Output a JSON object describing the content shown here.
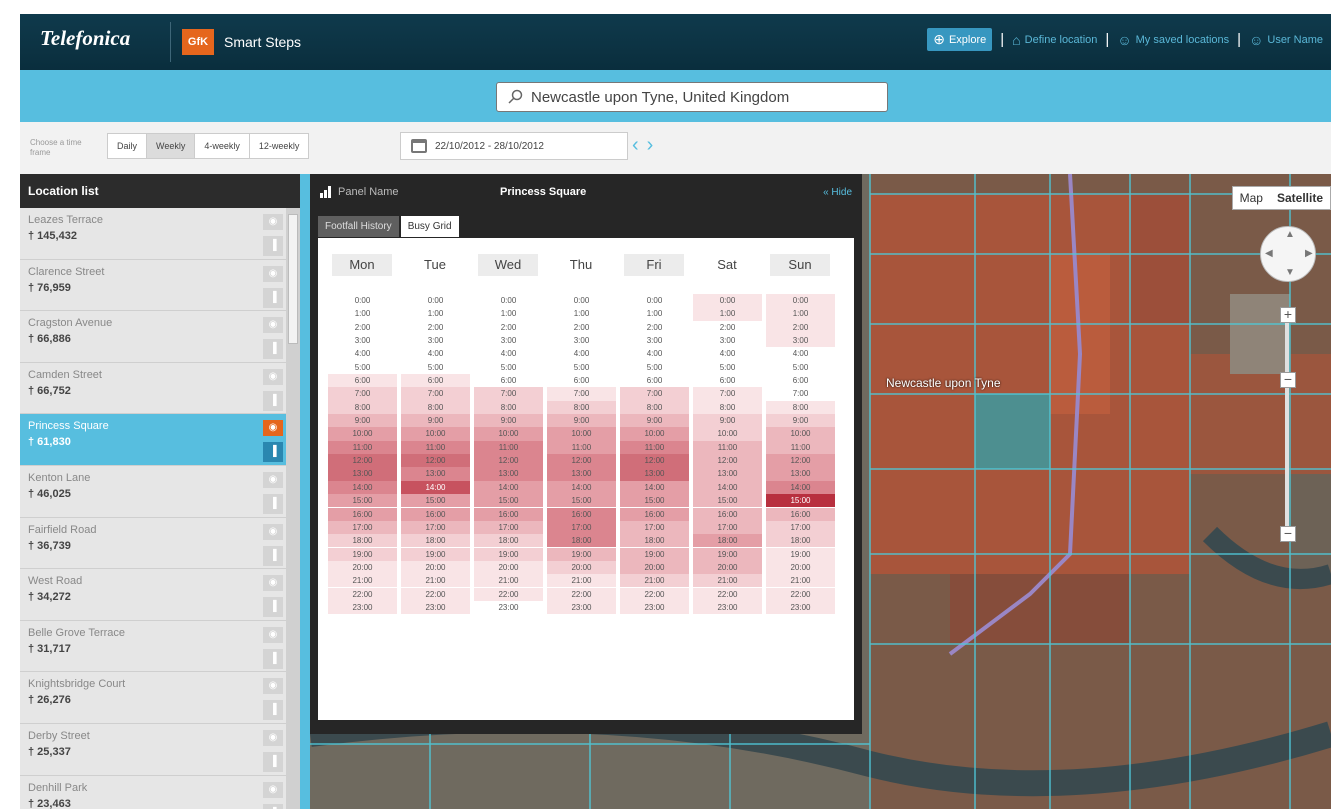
{
  "header": {
    "brand": "Telefonica",
    "partner_logo": "GfK",
    "app_name": "Smart Steps",
    "nav": [
      {
        "label": "Explore",
        "icon": "globe-icon"
      },
      {
        "label": "Define location",
        "icon": "house-icon"
      },
      {
        "label": "My saved locations",
        "icon": "users-icon"
      },
      {
        "label": "User Name",
        "icon": "user-icon"
      }
    ],
    "accent": "#57bedf"
  },
  "search": {
    "value": "Newcastle upon Tyne, United Kingdom",
    "icon": "search-icon"
  },
  "controls": {
    "choose_label": "Choose a time frame",
    "frames": [
      "Daily",
      "Weekly",
      "4-weekly",
      "12-weekly"
    ],
    "selected": "Weekly",
    "date_range": "22/10/2012 - 28/10/2012"
  },
  "sidebar": {
    "title": "Location list",
    "items": [
      {
        "name": "Leazes Terrace",
        "count": "145,432"
      },
      {
        "name": "Clarence Street",
        "count": "76,959"
      },
      {
        "name": "Cragston Avenue",
        "count": "66,886"
      },
      {
        "name": "Camden Street",
        "count": "66,752"
      },
      {
        "name": "Princess Square",
        "count": "61,830"
      },
      {
        "name": "Kenton Lane",
        "count": "46,025"
      },
      {
        "name": "Fairfield Road",
        "count": "36,739"
      },
      {
        "name": "West Road",
        "count": "34,272"
      },
      {
        "name": "Belle Grove Terrace",
        "count": "31,717"
      },
      {
        "name": "Knightsbridge Court",
        "count": "26,276"
      },
      {
        "name": "Derby Street",
        "count": "25,337"
      },
      {
        "name": "Denhill Park",
        "count": "23,463"
      }
    ],
    "active_index": 4
  },
  "panel": {
    "name_label": "Panel Name",
    "title": "Princess Square",
    "hide_label": "« Hide",
    "tabs": [
      "Footfall History",
      "Busy Grid"
    ],
    "active_tab": "Busy Grid"
  },
  "busy_grid": {
    "days": [
      "Mon",
      "Tue",
      "Wed",
      "Thu",
      "Fri",
      "Sat",
      "Sun"
    ],
    "hours": [
      "0:00",
      "1:00",
      "2:00",
      "3:00",
      "4:00",
      "5:00",
      "6:00",
      "7:00",
      "8:00",
      "9:00",
      "10:00",
      "11:00",
      "12:00",
      "13:00",
      "14:00",
      "15:00",
      "16:00",
      "17:00",
      "18:00",
      "19:00",
      "20:00",
      "21:00",
      "22:00",
      "23:00"
    ],
    "intensity": [
      [
        0,
        0,
        0,
        0,
        0,
        0,
        1,
        2,
        2,
        3,
        4,
        5,
        6,
        6,
        5,
        4,
        4,
        3,
        2,
        2,
        1,
        1,
        1,
        1
      ],
      [
        0,
        0,
        0,
        0,
        0,
        0,
        1,
        2,
        2,
        3,
        4,
        5,
        6,
        5,
        7,
        4,
        4,
        3,
        2,
        2,
        1,
        1,
        1,
        1
      ],
      [
        0,
        0,
        0,
        0,
        0,
        0,
        0,
        2,
        2,
        3,
        4,
        5,
        5,
        5,
        4,
        4,
        4,
        3,
        2,
        2,
        1,
        1,
        1,
        0
      ],
      [
        0,
        0,
        0,
        0,
        0,
        0,
        0,
        1,
        2,
        3,
        4,
        4,
        5,
        5,
        4,
        4,
        5,
        5,
        5,
        3,
        2,
        1,
        1,
        1
      ],
      [
        0,
        0,
        0,
        0,
        0,
        0,
        0,
        2,
        2,
        3,
        4,
        5,
        6,
        6,
        4,
        4,
        4,
        3,
        3,
        3,
        3,
        2,
        1,
        1
      ],
      [
        1,
        1,
        0,
        0,
        0,
        0,
        0,
        1,
        1,
        2,
        2,
        3,
        3,
        3,
        3,
        3,
        3,
        3,
        4,
        3,
        3,
        2,
        1,
        1
      ],
      [
        1,
        1,
        1,
        1,
        0,
        0,
        0,
        0,
        1,
        2,
        3,
        3,
        4,
        4,
        5,
        8,
        3,
        2,
        2,
        1,
        1,
        1,
        1,
        1
      ]
    ]
  },
  "map": {
    "type_options": [
      "Map",
      "Satellite"
    ],
    "selected": "Satellite",
    "place_label": "Newcastle upon Tyne"
  }
}
